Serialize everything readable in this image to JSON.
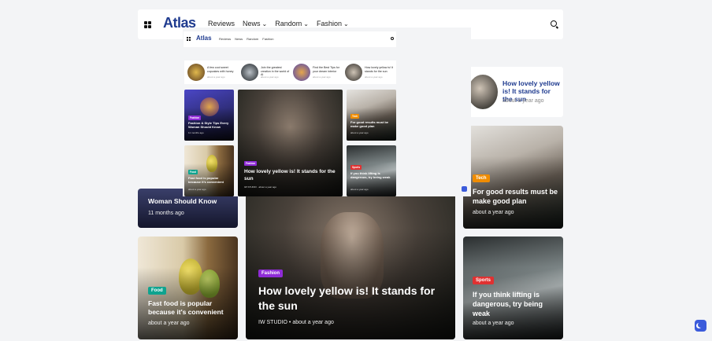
{
  "header": {
    "logo": "Atlas",
    "nav": [
      "Reviews",
      "News",
      "Random",
      "Fashion"
    ]
  },
  "side_post": {
    "title": "How lovely yellow is! It stands for the sun",
    "meta": "about a year ago"
  },
  "cards": {
    "tech": {
      "category": "Tech",
      "title": "For good results must be make good plan",
      "meta": "about a year ago"
    },
    "sports": {
      "category": "Sports",
      "title": "If you think lifting is dangerous, try being weak",
      "meta": "about a year ago"
    },
    "fashion": {
      "category": "Fashion",
      "title": "How lovely yellow is! It stands for the sun",
      "author": "IW STUDIO",
      "meta": "about a year ago"
    },
    "woman": {
      "title": "Woman Should Know",
      "meta": "11 months ago"
    },
    "food": {
      "category": "Food",
      "title": "Fast food is popular because it's convenient",
      "meta": "about a year ago"
    }
  },
  "overlay": {
    "logo": "Atlas",
    "nav": [
      "Reviews",
      "News",
      "Random",
      "Fashion"
    ],
    "strip": [
      {
        "title": "A few cool sweet cupcakes with honey",
        "meta": "about a year ago"
      },
      {
        "title": "Join the greatest creation in the world of AI",
        "meta": "about a year ago"
      },
      {
        "title": "Find the Best Tips for your dream interior",
        "meta": "about a year ago"
      },
      {
        "title": "How lovely yellow is! It stands for the sun",
        "meta": "about a year ago"
      }
    ],
    "cards": {
      "beauty": {
        "category": "Fashion",
        "title": "Fashion & Style Tips Every Woman Should Know",
        "meta": "11 months ago"
      },
      "fashion": {
        "category": "Fashion",
        "title": "How lovely yellow is! It stands for the sun",
        "meta": "IW STUDIO · about a year ago"
      },
      "tech": {
        "category": "Tech",
        "title": "For good results must be make good plan",
        "meta": "about a year ago"
      },
      "food": {
        "category": "Food",
        "title": "Fast food is popular because it's convenient",
        "meta": "about a year ago"
      },
      "sports": {
        "category": "Sports",
        "title": "If you think lifting is dangerous, try being weak",
        "meta": "about a year ago"
      }
    }
  },
  "colors": {
    "brand": "#1f3b8f",
    "tech": "#f08c00",
    "fashion": "#8f2bd6",
    "food": "#0fa38f",
    "sports": "#e03131",
    "accent": "#3b5bdb"
  }
}
